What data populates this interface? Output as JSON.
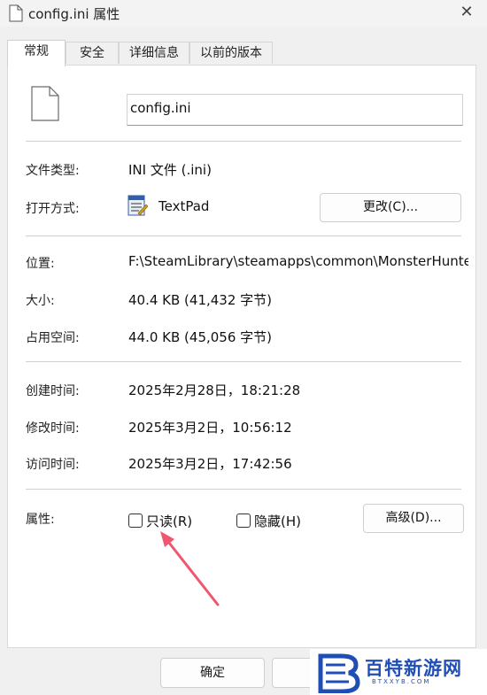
{
  "window": {
    "title": "config.ini 属性",
    "close_glyph": "✕"
  },
  "tabs": [
    {
      "label": "常规",
      "active": true
    },
    {
      "label": "安全",
      "active": false
    },
    {
      "label": "详细信息",
      "active": false
    },
    {
      "label": "以前的版本",
      "active": false
    }
  ],
  "general": {
    "filename": "config.ini",
    "file_type_label": "文件类型:",
    "file_type_value": "INI 文件 (.ini)",
    "opens_with_label": "打开方式:",
    "opens_with_value": "TextPad",
    "change_button": "更改(C)...",
    "location_label": "位置:",
    "location_value": "F:\\SteamLibrary\\steamapps\\common\\MonsterHunter",
    "size_label": "大小:",
    "size_value": "40.4 KB (41,432 字节)",
    "size_on_disk_label": "占用空间:",
    "size_on_disk_value": "44.0 KB (45,056 字节)",
    "created_label": "创建时间:",
    "created_value": "2025年2月28日，18:21:28",
    "modified_label": "修改时间:",
    "modified_value": "2025年3月2日，10:56:12",
    "accessed_label": "访问时间:",
    "accessed_value": "2025年3月2日，17:42:56",
    "attributes_label": "属性:",
    "readonly_label": "只读(R)",
    "readonly_checked": false,
    "hidden_label": "隐藏(H)",
    "hidden_checked": false,
    "advanced_button": "高级(D)..."
  },
  "footer": {
    "ok_button": "确定",
    "cancel_button": ""
  },
  "watermark": {
    "name": "百特新游网",
    "sub": "BTXXYB.COM",
    "color": "#1f4fb5"
  },
  "annotation": {
    "arrow_color": "#f0576e"
  }
}
